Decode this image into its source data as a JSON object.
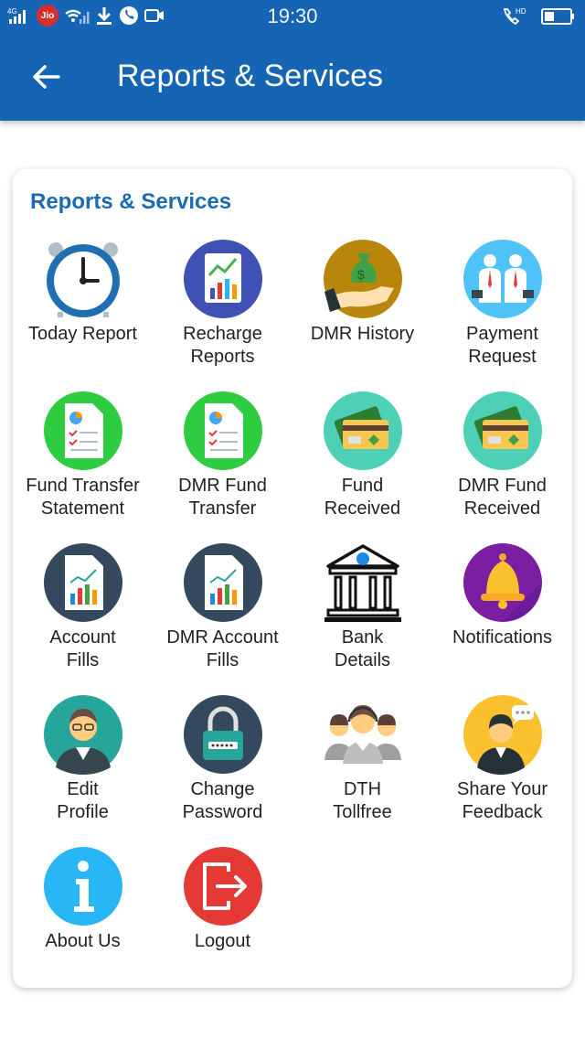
{
  "status_bar": {
    "network": "4G",
    "carrier_badge": "Jio",
    "time": "19:30",
    "call_icon_label": "HD"
  },
  "app_bar": {
    "title": "Reports & Services"
  },
  "section": {
    "title": "Reports & Services"
  },
  "tiles": [
    {
      "label": "Today Report",
      "icon": "clock-icon"
    },
    {
      "label": "Recharge\nReports",
      "icon": "report-chart-icon"
    },
    {
      "label": "DMR History",
      "icon": "money-bag-hand-icon"
    },
    {
      "label": "Payment\nRequest",
      "icon": "businessmen-icon"
    },
    {
      "label": "Fund Transfer\nStatement",
      "icon": "statement-document-icon"
    },
    {
      "label": "DMR Fund\nTransfer",
      "icon": "statement-document-icon"
    },
    {
      "label": "Fund\nReceived",
      "icon": "credit-card-icon"
    },
    {
      "label": "DMR Fund\nReceived",
      "icon": "credit-card-icon"
    },
    {
      "label": "Account\nFills",
      "icon": "bar-chart-document-icon"
    },
    {
      "label": "DMR Account\nFills",
      "icon": "bar-chart-document-icon"
    },
    {
      "label": "Bank\nDetails",
      "icon": "bank-building-icon"
    },
    {
      "label": "Notifications",
      "icon": "bell-icon"
    },
    {
      "label": "Edit\nProfile",
      "icon": "user-profile-icon"
    },
    {
      "label": "Change\nPassword",
      "icon": "padlock-icon"
    },
    {
      "label": "DTH\nTollfree",
      "icon": "support-agents-icon"
    },
    {
      "label": "Share Your\nFeedback",
      "icon": "feedback-chat-icon"
    },
    {
      "label": "About Us",
      "icon": "info-icon"
    },
    {
      "label": "Logout",
      "icon": "logout-icon"
    }
  ]
}
